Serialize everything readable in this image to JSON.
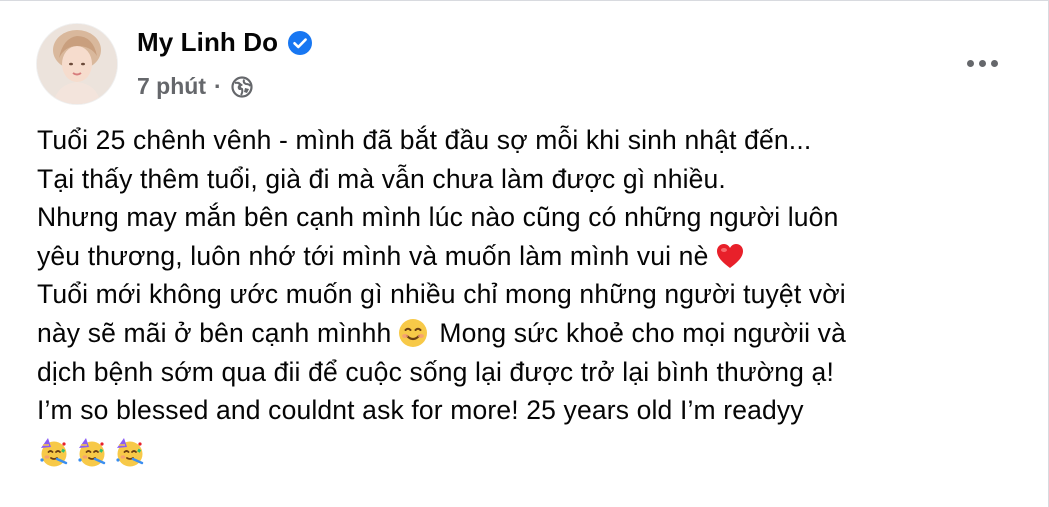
{
  "post": {
    "author": "My Linh Do",
    "time": "7 phút",
    "separator": "·",
    "lines": [
      "Tuổi 25 chênh vênh - mình đã bắt đầu sợ mỗi khi sinh nhật đến...",
      "Tại thấy thêm tuổi, già đi mà vẫn chưa làm được gì nhiều.",
      "Nhưng may mắn bên cạnh mình lúc nào cũng có những người luôn",
      "yêu thương, luôn nhớ tới mình và muốn làm mình vui nè",
      "Tuổi mới không ước muốn gì nhiều chỉ mong những người tuyệt vời",
      "này sẽ mãi ở bên cạnh mìnhh",
      "Mong sức khoẻ cho mọi ngườii và",
      "dịch bệnh sớm qua đii để cuộc sống lại được trở lại bình thường ạ!",
      "I’m so blessed and couldnt ask for more! 25 years old I’m readyy"
    ],
    "icons": {
      "verified": "verified-badge-icon",
      "audience": "globe-icon",
      "more": "more-options-icon",
      "heart": "red-heart-emoji",
      "smile": "smiling-face-emoji",
      "party": "partying-face-emoji"
    },
    "colors": {
      "accent": "#1877f2",
      "name": "#050505",
      "secondary": "#65676b",
      "heart": "#e8202a",
      "emoji_yellow": "#f7c948"
    }
  }
}
